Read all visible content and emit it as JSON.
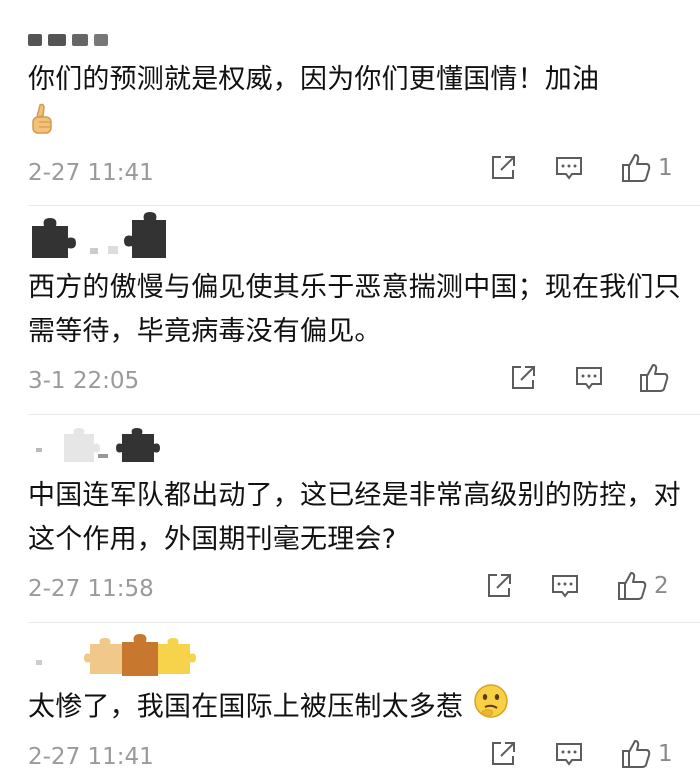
{
  "colors": {
    "text": "#111111",
    "meta": "#9a9a9a",
    "icon": "#5c5c5c",
    "divider": "#ebebeb"
  },
  "comments": [
    {
      "text": "你们的预测就是权威，因为你们更懂国情！加油",
      "emoji_icon": "thumbs-up-emoji-icon",
      "time": "2-27 11:41",
      "likes": "1"
    },
    {
      "text": "西方的傲慢与偏见使其乐于恶意揣测中国；现在我们只需等待，毕竟病毒没有偏见。",
      "time": "3-1 22:05",
      "likes": ""
    },
    {
      "text": "中国连军队都出动了，这已经是非常高级别的防控，对这个作用，外国期刊毫无理会?",
      "time": "2-27 11:58",
      "likes": "2"
    },
    {
      "text": "太惨了，我国在国际上被压制太多惹",
      "emoji_icon": "thinking-face-emoji-icon",
      "time": "2-27 11:41",
      "likes": "1"
    }
  ],
  "icons": {
    "share": "share-icon",
    "comment": "comment-icon",
    "like": "thumbs-up-icon",
    "avatar_mask": "puzzle-piece-icon"
  }
}
